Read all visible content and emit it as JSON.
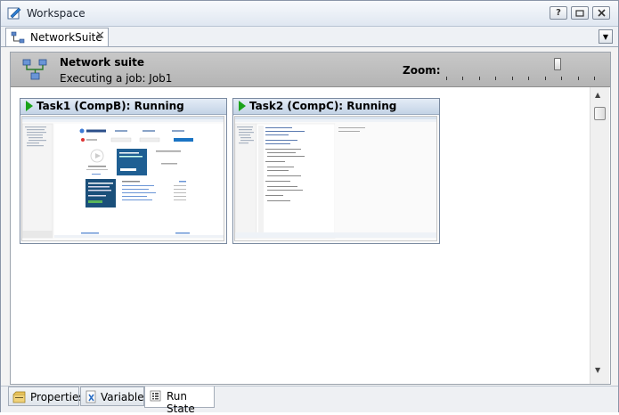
{
  "window": {
    "title": "Workspace",
    "help_label": "?",
    "colors": {
      "accent": "#1aa31a"
    }
  },
  "document_tab": {
    "label": "NetworkSuite",
    "close_label": "✕"
  },
  "header": {
    "title": "Network suite",
    "subtitle": "Executing a job: Job1",
    "zoom_label": "Zoom:",
    "zoom_level": 0.75
  },
  "tasks": [
    {
      "title": "Task1 (CompB): Running"
    },
    {
      "title": "Task2 (CompC): Running"
    }
  ],
  "bottom_tabs": [
    {
      "label": "Properties",
      "icon": "properties-icon"
    },
    {
      "label": "Variables",
      "icon": "variables-icon"
    },
    {
      "label": "Run State",
      "icon": "run-state-icon",
      "active": true
    }
  ]
}
